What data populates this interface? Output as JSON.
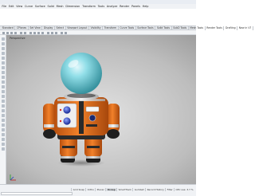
{
  "menubar": {
    "items": [
      "File",
      "Edit",
      "View",
      "Curve",
      "Surface",
      "Solid",
      "Mesh",
      "Dimension",
      "Transform",
      "Tools",
      "Analyze",
      "Render",
      "Panels",
      "Help"
    ]
  },
  "tabbar": {
    "tabs": [
      "Standard",
      "CPlanes",
      "Set View",
      "Display",
      "Select",
      "Viewport Layout",
      "Visibility",
      "Transform",
      "Curve Tools",
      "Surface Tools",
      "Solid Tools",
      "SubD Tools",
      "Mesh Tools",
      "Render Tools",
      "Drafting",
      "New in V7"
    ]
  },
  "viewport": {
    "label": "Perspective"
  },
  "statusbar": {
    "items": [
      {
        "label": "Grid Snap",
        "active": false
      },
      {
        "label": "Ortho",
        "active": false
      },
      {
        "label": "Planar",
        "active": false
      },
      {
        "label": "Osnap",
        "active": true
      },
      {
        "label": "SmartTrack",
        "active": false
      },
      {
        "label": "Gumball",
        "active": false
      },
      {
        "label": "Record History",
        "active": false
      },
      {
        "label": "Filter",
        "active": false
      },
      {
        "label": "CPU use: 3.7 %",
        "active": false
      }
    ]
  },
  "colors": {
    "suit": "#e8741f",
    "helmet": "#7fd6e0",
    "button": "#2a44c8",
    "viewport_bg": "#c4c4c4"
  }
}
